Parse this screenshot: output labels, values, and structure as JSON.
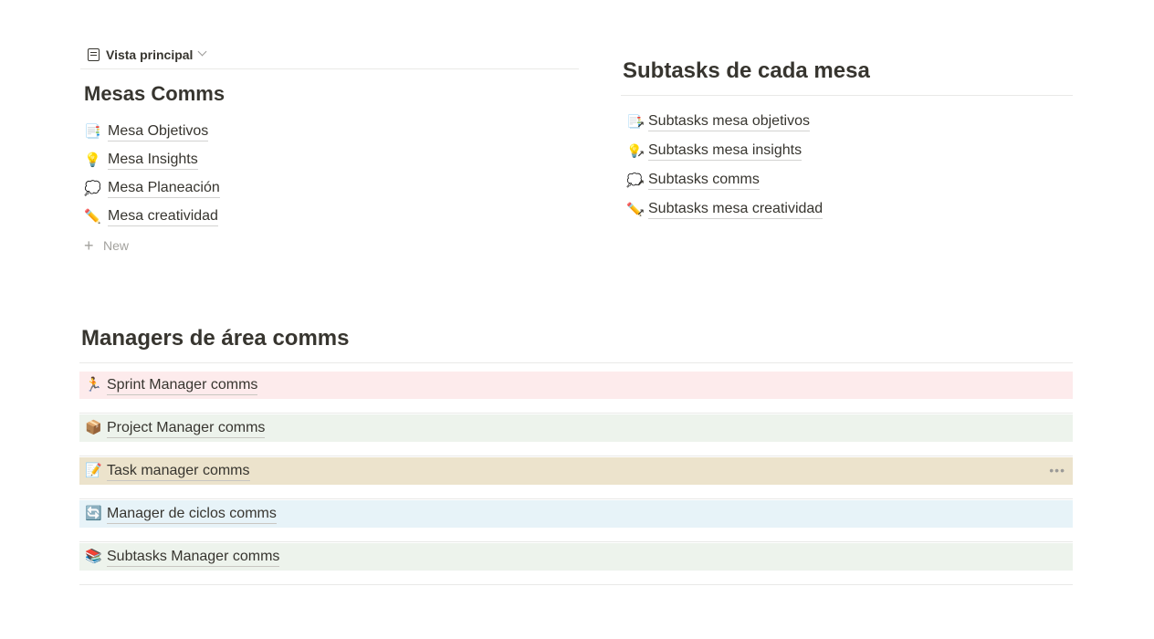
{
  "left": {
    "view_label": "Vista principal",
    "title": "Mesas Comms",
    "items": [
      {
        "emoji": "📑",
        "icon": "bookmark-tabs-icon",
        "label": "Mesa Objetivos"
      },
      {
        "emoji": "💡",
        "icon": "light-bulb-icon",
        "label": "Mesa Insights"
      },
      {
        "emoji": "💭",
        "icon": "thought-balloon-icon",
        "label": "Mesa Planeación"
      },
      {
        "emoji": "✏️",
        "icon": "pencil-icon",
        "label": "Mesa creatividad"
      }
    ],
    "new_label": "New"
  },
  "right": {
    "title": "Subtasks de cada mesa",
    "links": [
      {
        "emoji": "📑",
        "icon": "bookmark-tabs-icon",
        "label": "Subtasks mesa objetivos"
      },
      {
        "emoji": "💡",
        "icon": "light-bulb-icon",
        "label": "Subtasks mesa insights"
      },
      {
        "emoji": "💭",
        "icon": "thought-balloon-icon",
        "label": "Subtasks comms"
      },
      {
        "emoji": "✏️",
        "icon": "pencil-icon",
        "label": "Subtasks mesa creatividad"
      }
    ],
    "link_arrow": "↗"
  },
  "managers": {
    "title": "Managers de área comms",
    "items": [
      {
        "emoji": "🏃",
        "icon": "runner-icon",
        "label": "Sprint Manager comms",
        "bg": "#fdebec"
      },
      {
        "emoji": "📦",
        "icon": "package-icon",
        "label": "Project Manager comms",
        "bg": "#edf3ec"
      },
      {
        "emoji": "📝",
        "icon": "memo-icon",
        "label": "Task manager comms",
        "bg": "#ece3cc"
      },
      {
        "emoji": "🔄",
        "icon": "cycle-arrows-icon",
        "label": "Manager de ciclos comms",
        "bg": "#e7f3f8"
      },
      {
        "emoji": "📚",
        "icon": "books-icon",
        "label": "Subtasks Manager comms",
        "bg": "#edf3ec"
      }
    ],
    "more_icon": "•••"
  }
}
